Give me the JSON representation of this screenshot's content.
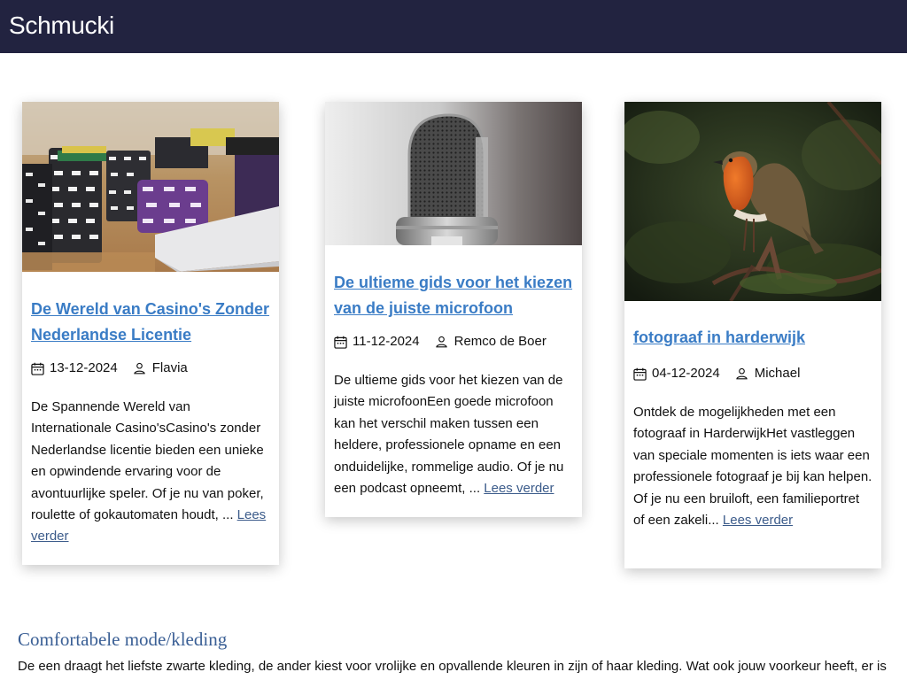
{
  "site": {
    "title": "Schmucki"
  },
  "colors": {
    "header_bg": "#222340",
    "link": "#3a7cc5",
    "section_title": "#3a5f95"
  },
  "posts": [
    {
      "title": "De Wereld van Casino's Zonder Nederlandse Licentie",
      "date": "13-12-2024",
      "author": "Flavia",
      "excerpt": "De Spannende Wereld van Internationale Casino'sCasino's zonder Nederlandse licentie bieden een unieke en opwindende ervaring voor de avontuurlijke speler. Of je nu van poker, roulette of gokautomaten houdt, ... ",
      "read_more": "Lees verder",
      "image": "casino-chips-photo"
    },
    {
      "title": "De ultieme gids voor het kiezen van de juiste microfoon",
      "date": "11-12-2024",
      "author": "Remco de Boer",
      "excerpt": "De ultieme gids voor het kiezen van de juiste microfoonEen goede microfoon kan het verschil maken tussen een heldere, professionele opname en een onduidelijke, rommelige audio. Of je nu een podcast opneemt, ... ",
      "read_more": "Lees verder",
      "image": "microphone-photo"
    },
    {
      "title": "fotograaf in harderwijk",
      "date": "04-12-2024",
      "author": "Michael",
      "excerpt": "Ontdek de mogelijkheden met een fotograaf in HarderwijkHet vastleggen van speciale momenten is iets waar een professionele fotograaf je bij kan helpen. Of je nu een bruiloft, een familieportret of een zakeli... ",
      "read_more": "Lees verder",
      "image": "robin-bird-photo"
    }
  ],
  "section": {
    "title": "Comfortabele mode/kleding",
    "text": "De een draagt het liefste zwarte kleding, de ander kiest voor vrolijke en opvallende kleuren in zijn of haar kleding. Wat ook jouw voorkeur heeft, er is"
  }
}
